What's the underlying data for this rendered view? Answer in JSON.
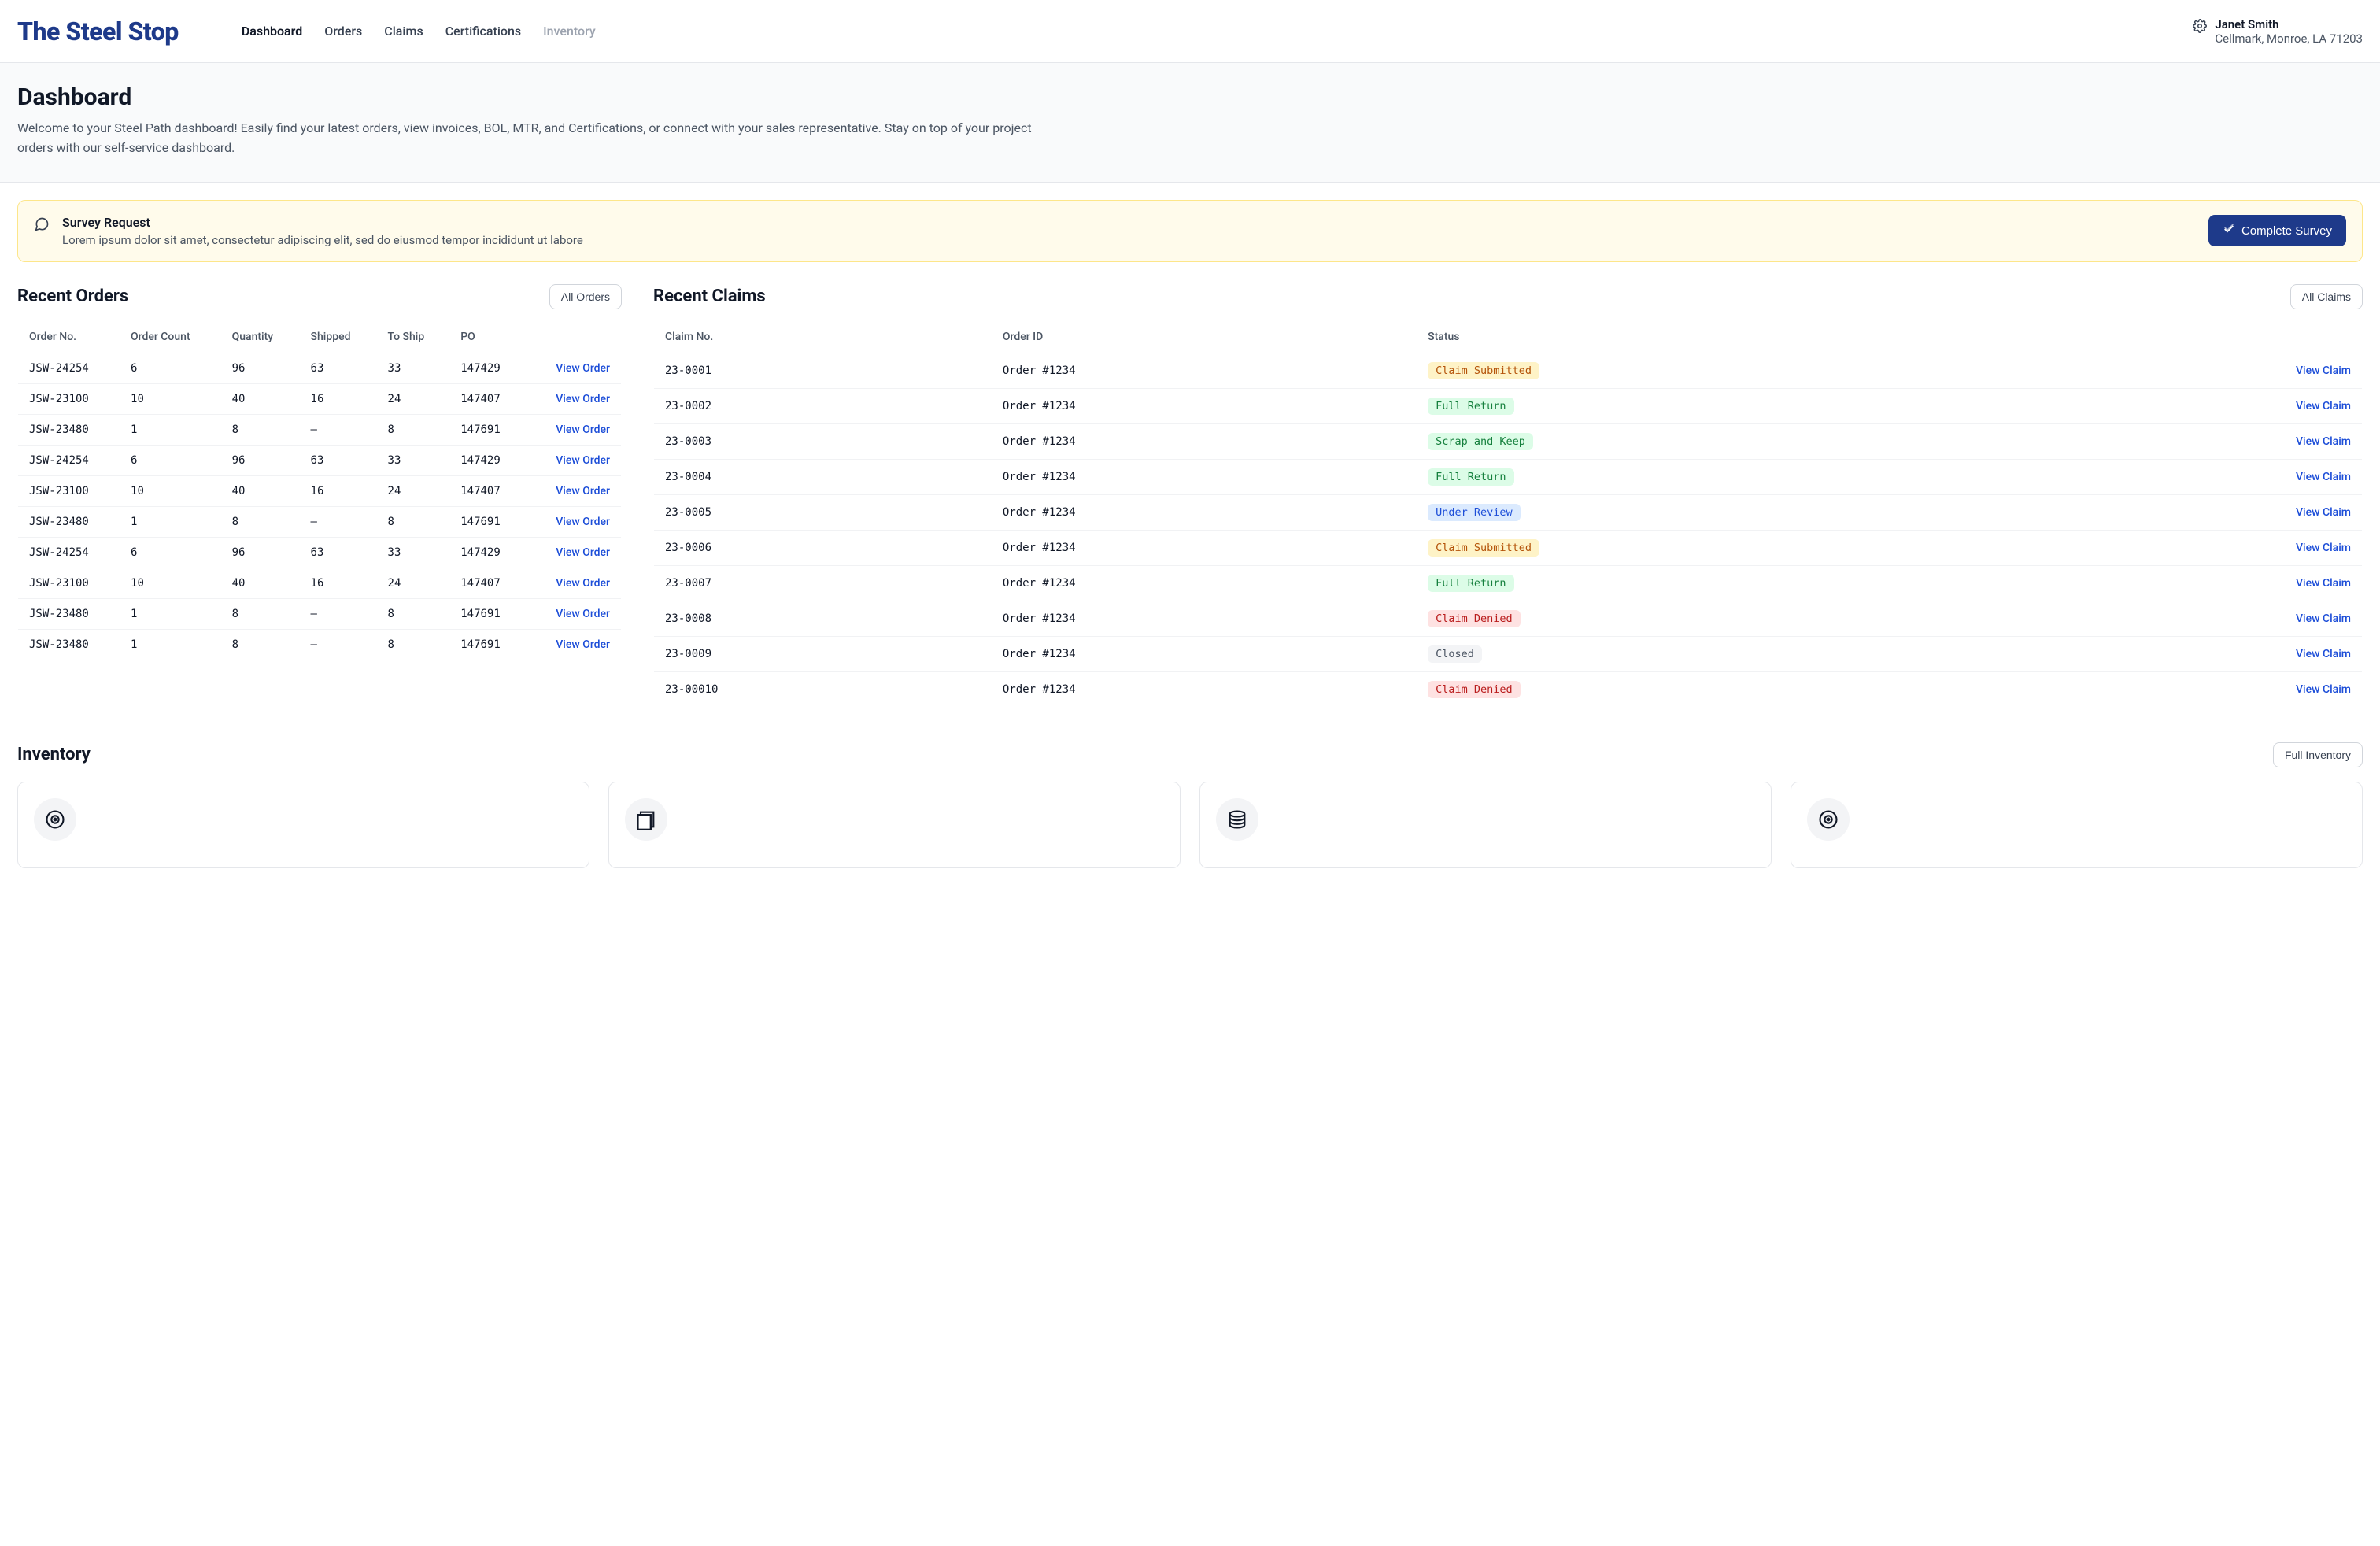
{
  "brand": "The Steel Stop",
  "nav": {
    "dashboard": "Dashboard",
    "orders": "Orders",
    "claims": "Claims",
    "certifications": "Certifications",
    "inventory": "Inventory"
  },
  "user": {
    "name": "Janet Smith",
    "org": "Cellmark, Monroe, LA 71203"
  },
  "hero": {
    "title": "Dashboard",
    "subtitle": "Welcome to your Steel Path dashboard! Easily find your latest orders, view invoices, BOL, MTR, and Certifications, or connect with your sales representative. Stay on top of your project orders with our self-service dashboard."
  },
  "survey": {
    "title": "Survey Request",
    "body": "Lorem ipsum dolor sit amet, consectetur adipiscing elit, sed do eiusmod tempor incididunt ut labore",
    "cta": "Complete Survey"
  },
  "orders": {
    "heading": "Recent Orders",
    "all_button": "All Orders",
    "view_label": "View Order",
    "columns": [
      "Order No.",
      "Order Count",
      "Quantity",
      "Shipped",
      "To Ship",
      "PO",
      ""
    ],
    "rows": [
      {
        "no": "JSW-24254",
        "count": "6",
        "qty": "96",
        "shipped": "63",
        "toship": "33",
        "po": "147429"
      },
      {
        "no": "JSW-23100",
        "count": "10",
        "qty": "40",
        "shipped": "16",
        "toship": "24",
        "po": "147407"
      },
      {
        "no": "JSW-23480",
        "count": "1",
        "qty": "8",
        "shipped": "–",
        "toship": "8",
        "po": "147691"
      },
      {
        "no": "JSW-24254",
        "count": "6",
        "qty": "96",
        "shipped": "63",
        "toship": "33",
        "po": "147429"
      },
      {
        "no": "JSW-23100",
        "count": "10",
        "qty": "40",
        "shipped": "16",
        "toship": "24",
        "po": "147407"
      },
      {
        "no": "JSW-23480",
        "count": "1",
        "qty": "8",
        "shipped": "–",
        "toship": "8",
        "po": "147691"
      },
      {
        "no": "JSW-24254",
        "count": "6",
        "qty": "96",
        "shipped": "63",
        "toship": "33",
        "po": "147429"
      },
      {
        "no": "JSW-23100",
        "count": "10",
        "qty": "40",
        "shipped": "16",
        "toship": "24",
        "po": "147407"
      },
      {
        "no": "JSW-23480",
        "count": "1",
        "qty": "8",
        "shipped": "–",
        "toship": "8",
        "po": "147691"
      },
      {
        "no": "JSW-23480",
        "count": "1",
        "qty": "8",
        "shipped": "–",
        "toship": "8",
        "po": "147691"
      }
    ]
  },
  "claims": {
    "heading": "Recent Claims",
    "all_button": "All Claims",
    "view_label": "View Claim",
    "columns": [
      "Claim No.",
      "Order ID",
      "Status",
      ""
    ],
    "rows": [
      {
        "no": "23-0001",
        "order": "Order #1234",
        "status": "Claim Submitted",
        "tone": "amber"
      },
      {
        "no": "23-0002",
        "order": "Order #1234",
        "status": "Full Return",
        "tone": "green"
      },
      {
        "no": "23-0003",
        "order": "Order #1234",
        "status": "Scrap and Keep",
        "tone": "green"
      },
      {
        "no": "23-0004",
        "order": "Order #1234",
        "status": "Full Return",
        "tone": "green"
      },
      {
        "no": "23-0005",
        "order": "Order #1234",
        "status": "Under Review",
        "tone": "blue"
      },
      {
        "no": "23-0006",
        "order": "Order #1234",
        "status": "Claim Submitted",
        "tone": "amber"
      },
      {
        "no": "23-0007",
        "order": "Order #1234",
        "status": "Full Return",
        "tone": "green"
      },
      {
        "no": "23-0008",
        "order": "Order #1234",
        "status": "Claim Denied",
        "tone": "red"
      },
      {
        "no": "23-0009",
        "order": "Order #1234",
        "status": "Closed",
        "tone": "gray"
      },
      {
        "no": "23-00010",
        "order": "Order #1234",
        "status": "Claim Denied",
        "tone": "red"
      }
    ]
  },
  "inventory": {
    "heading": "Inventory",
    "all_button": "Full Inventory",
    "cards": [
      {
        "icon": "coil"
      },
      {
        "icon": "sheet"
      },
      {
        "icon": "stack"
      },
      {
        "icon": "coil"
      }
    ]
  }
}
